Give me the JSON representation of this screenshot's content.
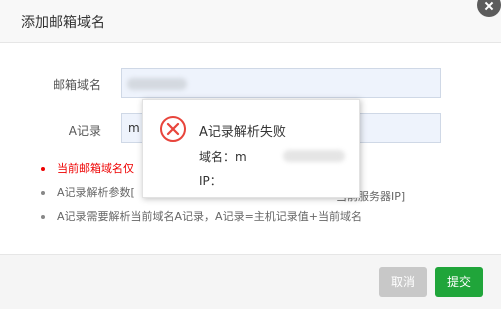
{
  "dialog": {
    "title": "添加邮箱域名",
    "close_icon": "close-icon"
  },
  "form": {
    "domain_label": "邮箱域名",
    "domain_value": "",
    "a_label": "A记录",
    "a_value": "m"
  },
  "tips": [
    {
      "text": "当前邮箱域名仅",
      "color": "#ee0000"
    },
    {
      "text": "A记录解析参数[",
      "right": "当前服务器IP]"
    },
    {
      "text": "A记录需要解析当前域名A记录，A记录=主机记录值+当前域名"
    }
  ],
  "popup": {
    "icon": "error-x-icon",
    "title": "A记录解析失败",
    "domain_line": "域名：",
    "domain_partial": "m",
    "ip_line": "IP："
  },
  "footer": {
    "cancel_label": "取消",
    "submit_label": "提交"
  },
  "colors": {
    "submit": "#20a53a",
    "cancel": "#c8c8c8",
    "error": "#e8453c"
  }
}
